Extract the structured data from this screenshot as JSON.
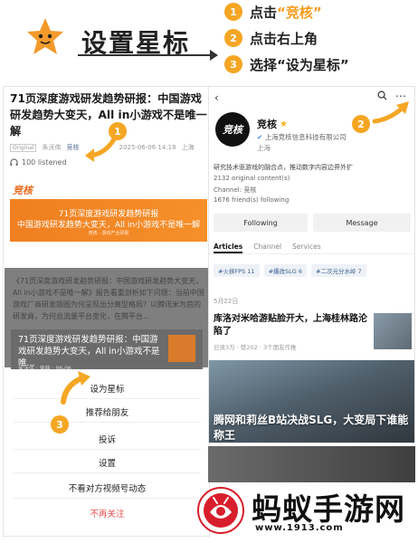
{
  "header": {
    "title": "设置星标",
    "mascot_icon": "orange-star-mascot",
    "steps": [
      {
        "num": "1",
        "prefix": "点击",
        "highlight": "“竞核”",
        "suffix": ""
      },
      {
        "num": "2",
        "prefix": "点击右上角",
        "highlight": "",
        "suffix": ""
      },
      {
        "num": "3",
        "prefix": "选择",
        "highlight": "",
        "suffix": "“设为星标”"
      }
    ]
  },
  "left": {
    "article_title": "71页深度游戏研发趋势研报：中国游戏研发趋势大变天，All in小游戏不是唯一解",
    "meta": {
      "tag": "Original",
      "author": "朱沃伟",
      "account": "竞核",
      "date": "2025-06-06 14:18",
      "location": "上海"
    },
    "listened": "100 listened",
    "logo_small": "竞核",
    "banner": {
      "line1": "71页深度游戏研发趋势研报",
      "line2": "中国游戏研发趋势大变天，All in小游戏不是唯一解",
      "line3": "竞核 · 游戏产业研报"
    },
    "body_text": "《71页深度游戏研发趋势研报：中国游戏研发趋势大变天，All in小游戏不是唯一解》报告看重剖析如下问题：当前中国游戏厂商研发版图为何呈现出分离型格局？以腾讯米为首的研发商，为何总流量平台变化，在腾平台...",
    "share_card": {
      "title": "71页深度游戏研发趋势研报：中国游戏研发趋势大变天，All in小游戏不是唯...",
      "meta": "朱沃伟 · 竞核 · 06-06"
    },
    "menu": [
      "设为星标",
      "推荐给朋友",
      "投诉",
      "设置",
      "不看对方视频号动态",
      "不再关注"
    ]
  },
  "right": {
    "back_icon": "back-arrow-icon",
    "account_name": "竞核",
    "avatar_text": "竞核",
    "org": "上海竞核信息科技有限公司",
    "location": "上海",
    "description": "研究技术驱游戏的融合点，推动数字内容边界外扩",
    "stats": [
      "2132 original content(s)",
      "Channel: 竞核",
      "1676 friend(s) following"
    ],
    "follow_btn": "Following",
    "message_btn": "Message",
    "tabs": [
      "Articles",
      "Channel",
      "Services"
    ],
    "chips": [
      "#火拼FPS 11",
      "#爆改SLG 6",
      "#二次元分水岭 7"
    ],
    "date": "5月22日",
    "post_title": "库洛对米哈游贴脸开大，上海桂林路沦陷了",
    "post_meta": "已读3万 · 赞202 · 3个朋友作推",
    "game_caption": "腾网和莉丝B站决战SLG，大变局下谁能称王"
  },
  "badges": [
    "1",
    "2",
    "3"
  ],
  "watermark": {
    "text": "蚂蚁手游网",
    "url": "www.1913.com"
  },
  "colors": {
    "accent": "#f5a623",
    "highlight": "#f59a1b",
    "banner": "#f07f20",
    "cancel": "#e84a4a"
  }
}
